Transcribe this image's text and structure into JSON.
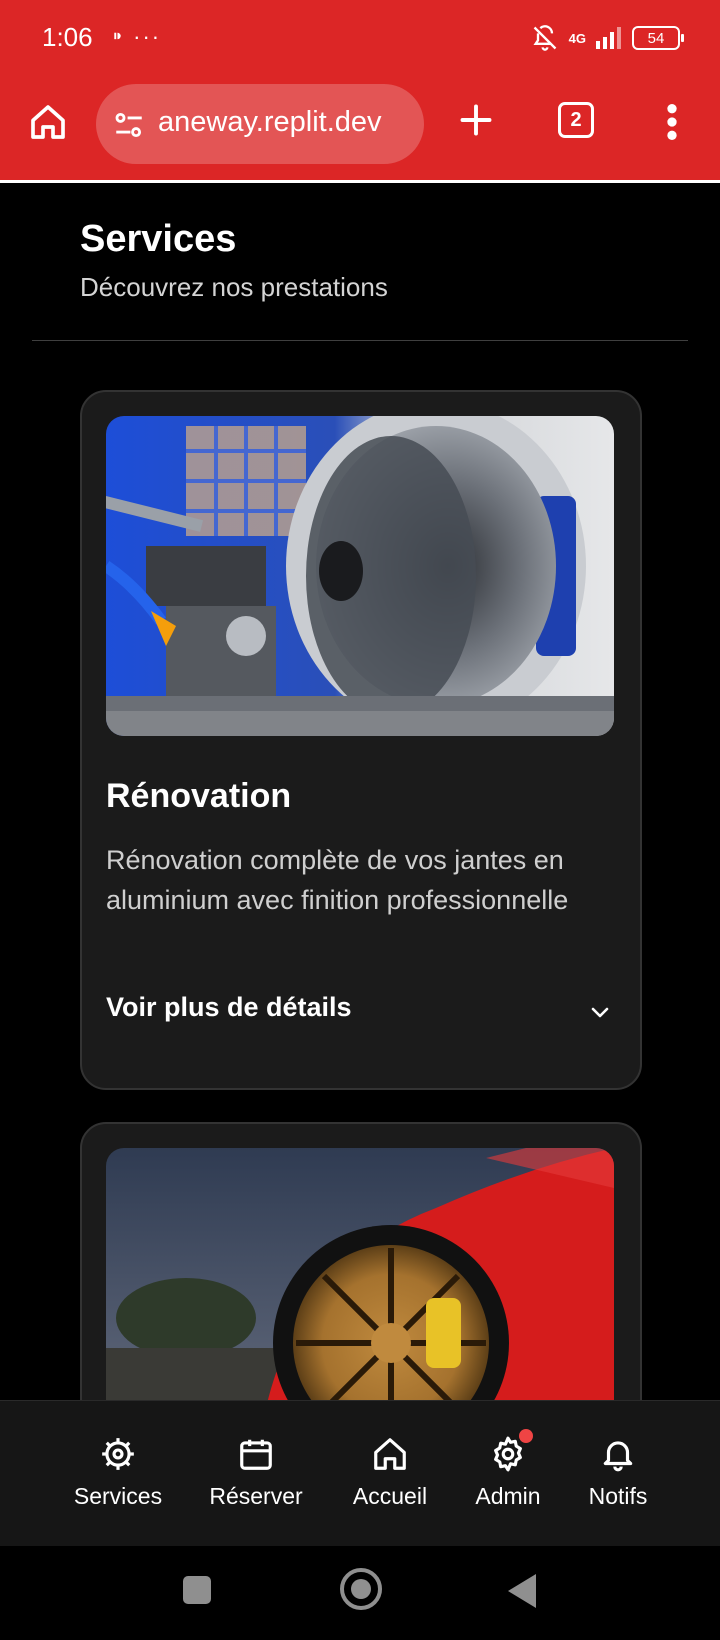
{
  "status_bar": {
    "time": "1:06",
    "left_icons": "⁍ ···",
    "network": "4G",
    "battery": "54"
  },
  "browser": {
    "url": "aneway.replit.dev",
    "tab_count": "2"
  },
  "page": {
    "title": "Services",
    "subtitle": "Découvrez nos prestations"
  },
  "services": [
    {
      "title": "Rénovation",
      "description": "Rénovation complète de vos jantes en aluminium avec finition professionnelle",
      "details_label": "Voir plus de détails"
    }
  ],
  "bottom_nav": {
    "items": [
      {
        "label": "Services",
        "icon": "gear-cog-icon"
      },
      {
        "label": "Réserver",
        "icon": "calendar-icon"
      },
      {
        "label": "Accueil",
        "icon": "home-icon"
      },
      {
        "label": "Admin",
        "icon": "settings-icon"
      },
      {
        "label": "Notifs",
        "icon": "bell-icon"
      }
    ]
  },
  "colors": {
    "brand": "#dc2626",
    "background": "#000000",
    "card": "#1b1b1b",
    "notification_dot": "#ef4444"
  }
}
